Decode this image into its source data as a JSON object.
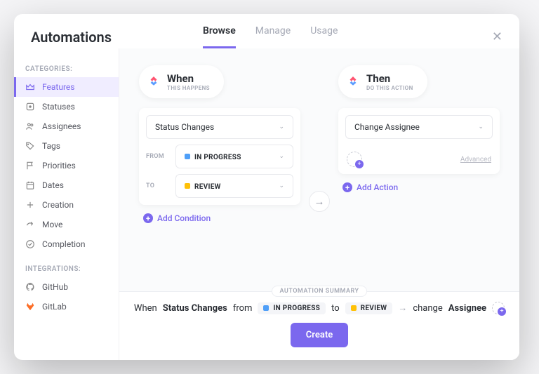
{
  "header": {
    "title": "Automations",
    "tabs": [
      "Browse",
      "Manage",
      "Usage"
    ],
    "activeTab": 0
  },
  "sidebar": {
    "categoriesLabel": "CATEGORIES:",
    "integrationsLabel": "INTEGRATIONS:",
    "categories": [
      {
        "label": "Features",
        "icon": "crown"
      },
      {
        "label": "Statuses",
        "icon": "square"
      },
      {
        "label": "Assignees",
        "icon": "people"
      },
      {
        "label": "Tags",
        "icon": "tag"
      },
      {
        "label": "Priorities",
        "icon": "flag"
      },
      {
        "label": "Dates",
        "icon": "calendar"
      },
      {
        "label": "Creation",
        "icon": "plus"
      },
      {
        "label": "Move",
        "icon": "share"
      },
      {
        "label": "Completion",
        "icon": "check"
      }
    ],
    "integrations": [
      {
        "label": "GitHub",
        "icon": "github"
      },
      {
        "label": "GitLab",
        "icon": "gitlab"
      }
    ],
    "activeCategory": 0
  },
  "when": {
    "title": "When",
    "subtitle": "THIS HAPPENS",
    "trigger": "Status Changes",
    "fromLabel": "FROM",
    "toLabel": "TO",
    "fromStatus": {
      "label": "IN PROGRESS",
      "color": "#4f9ff8"
    },
    "toStatus": {
      "label": "REVIEW",
      "color": "#ffc107"
    },
    "addCondition": "Add Condition"
  },
  "then": {
    "title": "Then",
    "subtitle": "DO THIS ACTION",
    "action": "Change Assignee",
    "advanced": "Advanced",
    "addAction": "Add Action"
  },
  "summary": {
    "label": "AUTOMATION SUMMARY",
    "whenWord": "When",
    "trigger": "Status Changes",
    "fromWord": "from",
    "toWord": "to",
    "changeWord": "change",
    "actionTarget": "Assignee",
    "createButton": "Create"
  }
}
